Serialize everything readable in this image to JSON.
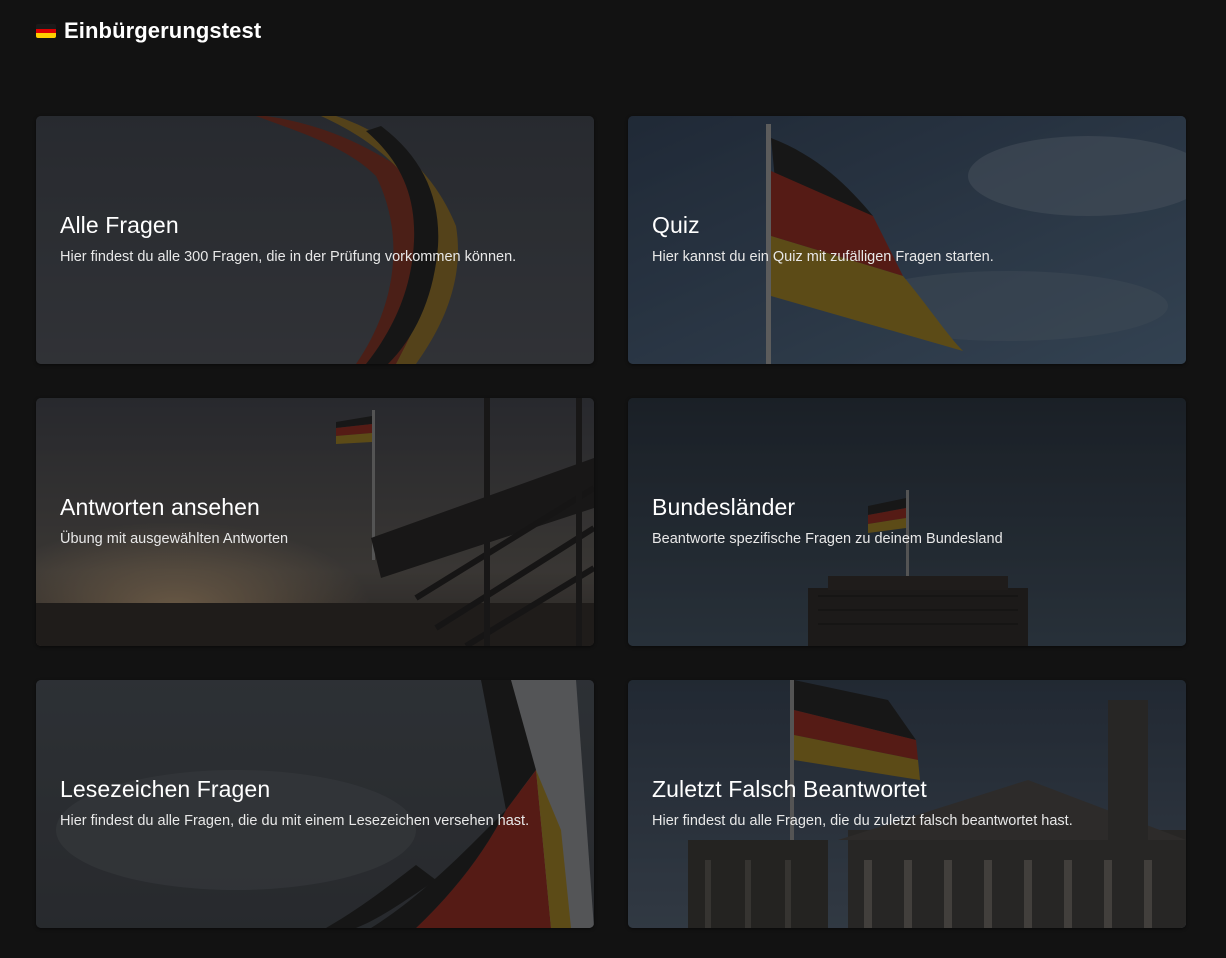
{
  "header": {
    "title": "Einbürgerungstest",
    "icon": "german-flag-icon"
  },
  "colors": {
    "background": "#121212",
    "flag_black": "#1a1a1a",
    "flag_red": "#dd0000",
    "flag_gold": "#ffce00"
  },
  "cards": [
    {
      "title": "Alle Fragen",
      "description": "Hier findest du alle 300 Fragen, die in der Prüfung vorkommen können."
    },
    {
      "title": "Quiz",
      "description": "Hier kannst du ein Quiz mit zufälligen Fragen starten."
    },
    {
      "title": "Antworten ansehen",
      "description": "Übung mit ausgewählten Antworten"
    },
    {
      "title": "Bundesländer",
      "description": "Beantworte spezifische Fragen zu deinem Bundesland"
    },
    {
      "title": "Lesezeichen Fragen",
      "description": "Hier findest du alle Fragen, die du mit einem Lesezeichen versehen hast."
    },
    {
      "title": "Zuletzt Falsch Beantwortet",
      "description": "Hier findest du alle Fragen, die du zuletzt falsch beantwortet hast."
    }
  ]
}
